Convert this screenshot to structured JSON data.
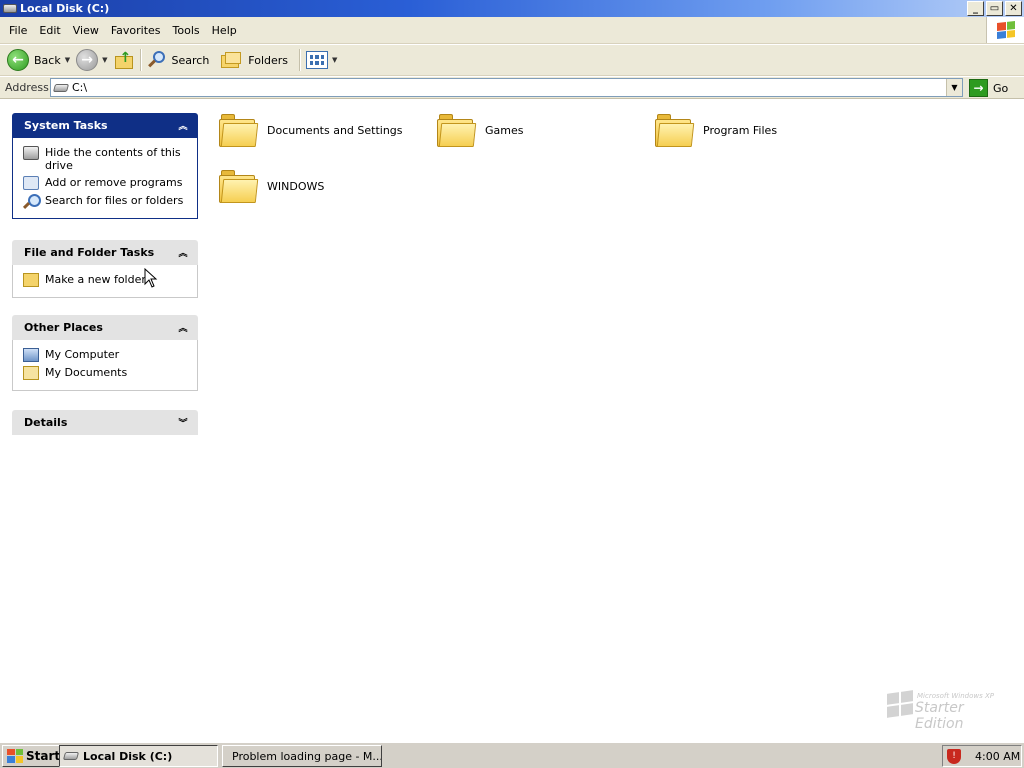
{
  "window": {
    "title": "Local Disk (C:)"
  },
  "menu": [
    "File",
    "Edit",
    "View",
    "Favorites",
    "Tools",
    "Help"
  ],
  "toolbar": {
    "back": "Back",
    "search": "Search",
    "folders": "Folders"
  },
  "address": {
    "label": "Address",
    "value": "C:\\",
    "go": "Go"
  },
  "system_tasks": {
    "title": "System Tasks",
    "items": [
      "Hide the contents of this drive",
      "Add or remove programs",
      "Search for files or folders"
    ]
  },
  "file_folder_tasks": {
    "title": "File and Folder Tasks",
    "items": [
      "Make a new folder"
    ]
  },
  "other_places": {
    "title": "Other Places",
    "items": [
      "My Computer",
      "My Documents"
    ]
  },
  "details": {
    "title": "Details"
  },
  "folders": [
    "Documents and Settings",
    "Games",
    "Program Files",
    "WINDOWS"
  ],
  "watermark": {
    "top": "Microsoft Windows XP",
    "main": "Starter Edition"
  },
  "taskbar": {
    "start": "Start",
    "tasks": [
      "Local Disk (C:)",
      "Problem loading page - M..."
    ],
    "clock": "4:00 AM"
  },
  "colors": {
    "title_blue": "#2a5fd6",
    "task_pane_header": "#0f2f86",
    "chrome": "#ece9d8",
    "folder_yellow": "#f1c33f"
  }
}
